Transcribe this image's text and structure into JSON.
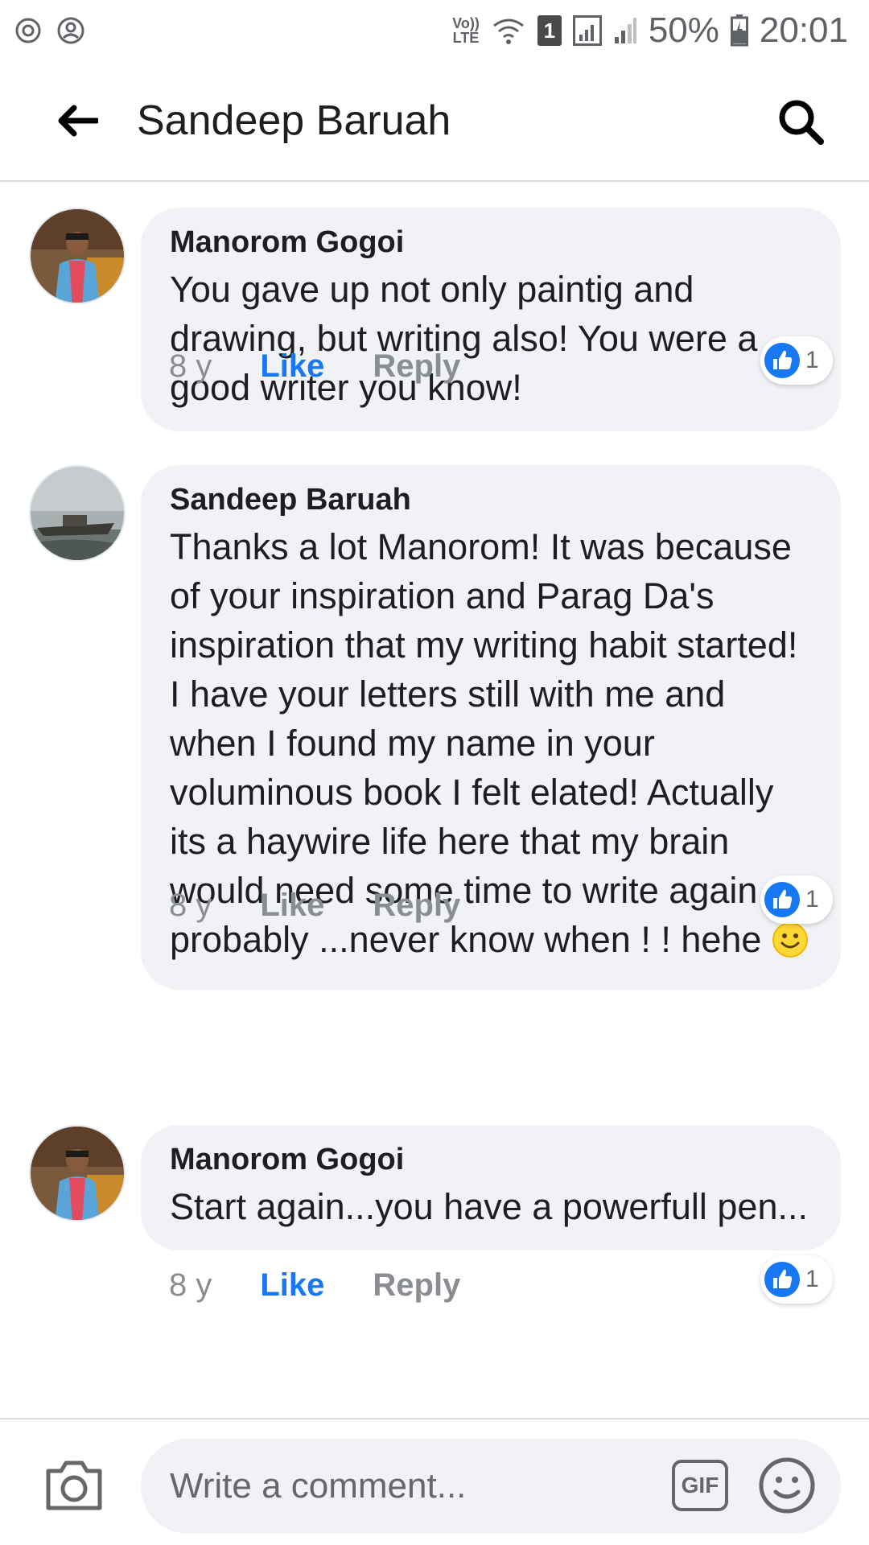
{
  "status_bar": {
    "volte_top": "Vo))",
    "volte_bottom": "LTE",
    "sim": "1",
    "battery": "50%",
    "time": "20:01"
  },
  "header": {
    "title": "Sandeep Baruah"
  },
  "comments": [
    {
      "author": "Manorom Gogoi",
      "text": "You gave up not only paintig and drawing, but writing also! You were a good writer you know!",
      "time": "8 y",
      "like_label": "Like",
      "liked": true,
      "reply_label": "Reply",
      "reaction_count": "1"
    },
    {
      "author": "Sandeep Baruah",
      "text": "Thanks a lot Manorom! It was because of your inspiration and Parag Da's inspiration that my writing habit started! I have your letters still with me and when I found my name in your voluminous book I felt elated! Actually its a haywire life here that my brain would need some time to write again probably ...never know when ! ! hehe",
      "time": "8 y",
      "like_label": "Like",
      "liked": false,
      "reply_label": "Reply",
      "reaction_count": "1"
    },
    {
      "author": "Manorom Gogoi",
      "text": "Start again...you have a powerfull pen...",
      "time": "8 y",
      "like_label": "Like",
      "liked": true,
      "reply_label": "Reply",
      "reaction_count": "1"
    }
  ],
  "composer": {
    "placeholder": "Write a comment...",
    "gif_label": "GIF"
  },
  "colors": {
    "accent": "#1877f2",
    "bubble": "#f0f2f5",
    "muted": "#8a8d91"
  }
}
